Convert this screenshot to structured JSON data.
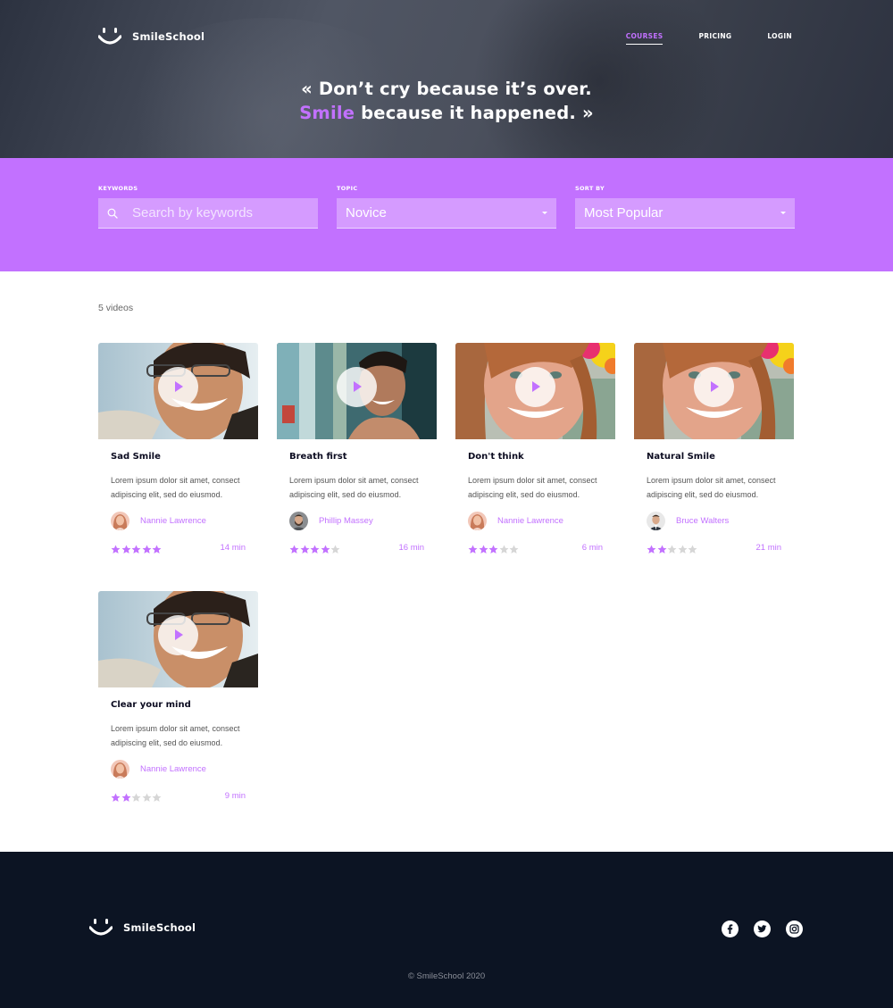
{
  "brand": {
    "name": "SmileSchool"
  },
  "nav": {
    "items": [
      {
        "label": "COURSES",
        "active": true
      },
      {
        "label": "PRICING",
        "active": false
      },
      {
        "label": "LOGIN",
        "active": false
      }
    ]
  },
  "hero": {
    "quote_line1": "« Don’t cry because it’s over.",
    "quote_highlight": "Smile",
    "quote_line2_rest": " because it happened. »"
  },
  "filters": {
    "keywords_label": "KEYWORDS",
    "keywords_placeholder": "Search by keywords",
    "topic_label": "TOPIC",
    "topic_value": "Novice",
    "sort_label": "SORT BY",
    "sort_value": "Most Popular"
  },
  "results": {
    "count_text": "5 videos"
  },
  "videos": [
    {
      "title": "Sad Smile",
      "desc": "Lorem ipsum dolor sit amet, consect adipiscing elit, sed do eiusmod.",
      "author": "Nannie Lawrence",
      "rating": 5,
      "duration": "14 min",
      "thumb": "glasses-man",
      "avatar": "woman"
    },
    {
      "title": "Breath first",
      "desc": "Lorem ipsum dolor sit amet, consect adipiscing elit, sed do eiusmod.",
      "author": "Phillip Massey",
      "rating": 4,
      "duration": "16 min",
      "thumb": "city-man",
      "avatar": "bearded-man"
    },
    {
      "title": "Don't think",
      "desc": "Lorem ipsum dolor sit amet, consect adipiscing elit, sed do eiusmod.",
      "author": "Nannie Lawrence",
      "rating": 3,
      "duration": "6 min",
      "thumb": "redhead-woman",
      "avatar": "woman"
    },
    {
      "title": "Natural Smile",
      "desc": "Lorem ipsum dolor sit amet, consect adipiscing elit, sed do eiusmod.",
      "author": "Bruce Walters",
      "rating": 2,
      "duration": "21 min",
      "thumb": "redhead-woman",
      "avatar": "suit-man"
    },
    {
      "title": "Clear your mind",
      "desc": "Lorem ipsum dolor sit amet, consect adipiscing elit, sed do eiusmod.",
      "author": "Nannie Lawrence",
      "rating": 2,
      "duration": "9 min",
      "thumb": "glasses-man",
      "avatar": "woman"
    }
  ],
  "footer": {
    "copyright": "© SmileSchool 2020",
    "socials": [
      "facebook-icon",
      "twitter-icon",
      "instagram-icon"
    ]
  },
  "colors": {
    "accent": "#c271ff",
    "footer_bg": "#0c1423",
    "star_off": "#d6d6d6"
  }
}
